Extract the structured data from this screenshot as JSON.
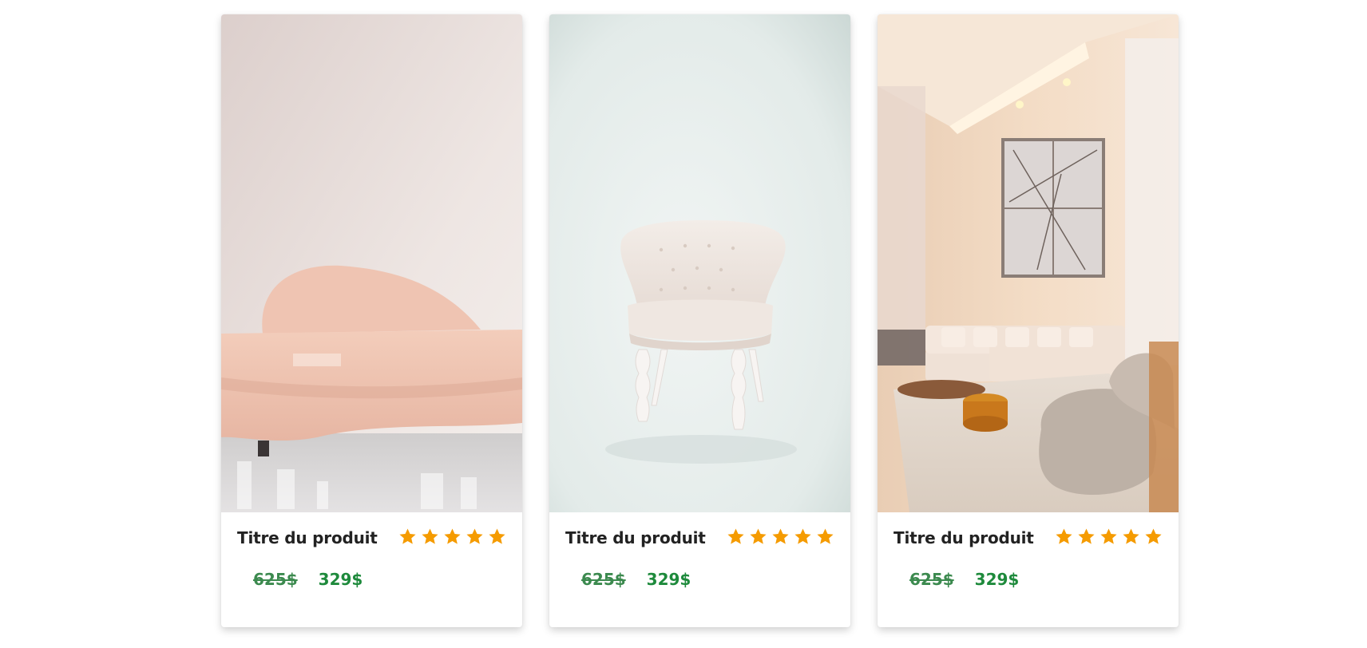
{
  "colors": {
    "star": "#f59b00",
    "title": "#222222",
    "old_price": "#3c8a4f",
    "new_price": "#1e8a3c"
  },
  "products": [
    {
      "image_icon": "pink-sofa-photo",
      "title": "Titre du produit",
      "rating": 5,
      "old_price": "625$",
      "new_price": "329$"
    },
    {
      "image_icon": "white-armchair-photo",
      "title": "Titre du produit",
      "rating": 5,
      "old_price": "625$",
      "new_price": "329$"
    },
    {
      "image_icon": "living-room-photo",
      "title": "Titre du produit",
      "rating": 5,
      "old_price": "625$",
      "new_price": "329$"
    }
  ]
}
